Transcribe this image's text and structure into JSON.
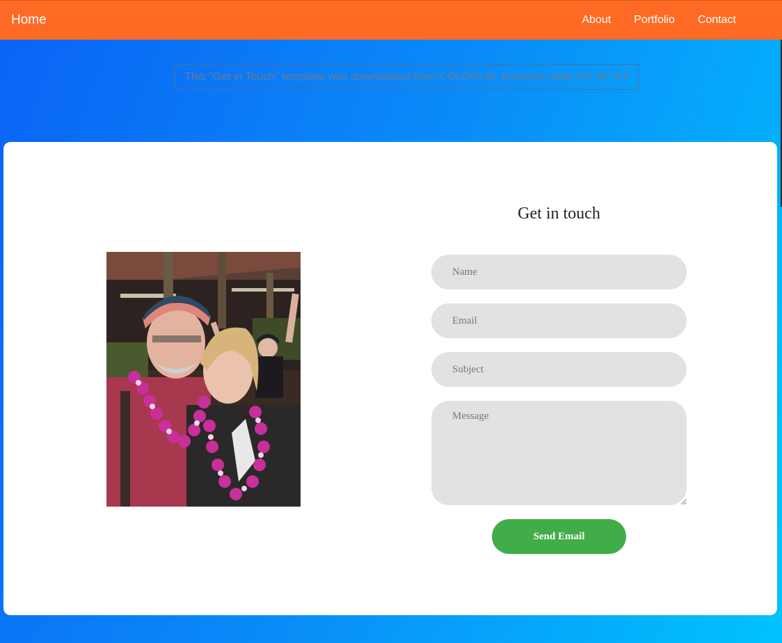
{
  "nav": {
    "brand": "Home",
    "links": [
      "About",
      "Portfolio",
      "Contact"
    ]
  },
  "notice": "This \"Get in Touch\" template was downloaded from COLORLIB, licensed under CC BY 3.0",
  "contact": {
    "heading": "Get in touch",
    "placeholders": {
      "name": "Name",
      "email": "Email",
      "subject": "Subject",
      "message": "Message"
    },
    "button": "Send Email"
  },
  "colors": {
    "nav_background": "#fe6a24",
    "gradient_start": "#0a63f5",
    "gradient_end": "#00c2fd",
    "field_background": "#e2e2e2",
    "button": "#41ad49"
  }
}
